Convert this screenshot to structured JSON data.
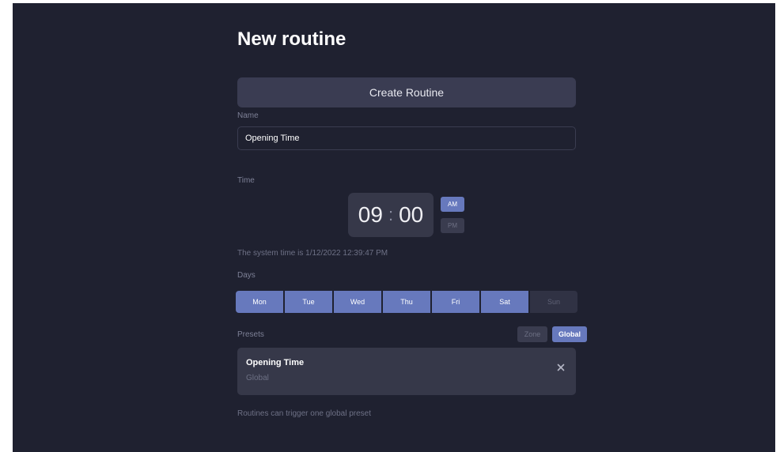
{
  "page": {
    "title": "New routine",
    "create_button_label": "Create Routine"
  },
  "name": {
    "label": "Name",
    "value": "Opening Time"
  },
  "time": {
    "label": "Time",
    "hours": "09",
    "separator": ":",
    "minutes": "00",
    "am_label": "AM",
    "pm_label": "PM",
    "selected_period": "AM",
    "system_time_text": "The system time is 1/12/2022 12:39:47 PM"
  },
  "days": {
    "label": "Days",
    "items": [
      {
        "label": "Mon",
        "selected": true
      },
      {
        "label": "Tue",
        "selected": true
      },
      {
        "label": "Wed",
        "selected": true
      },
      {
        "label": "Thu",
        "selected": true
      },
      {
        "label": "Fri",
        "selected": true
      },
      {
        "label": "Sat",
        "selected": true
      },
      {
        "label": "Sun",
        "selected": false
      }
    ]
  },
  "presets": {
    "label": "Presets",
    "zone_label": "Zone",
    "global_label": "Global",
    "selected_scope": "Global",
    "items": [
      {
        "name": "Opening Time",
        "scope": "Global",
        "remove_icon": "close-icon"
      }
    ],
    "footnote": "Routines can trigger one global preset"
  },
  "colors": {
    "background": "#1f2130",
    "accent": "#6779bd",
    "surface": "#363849"
  }
}
